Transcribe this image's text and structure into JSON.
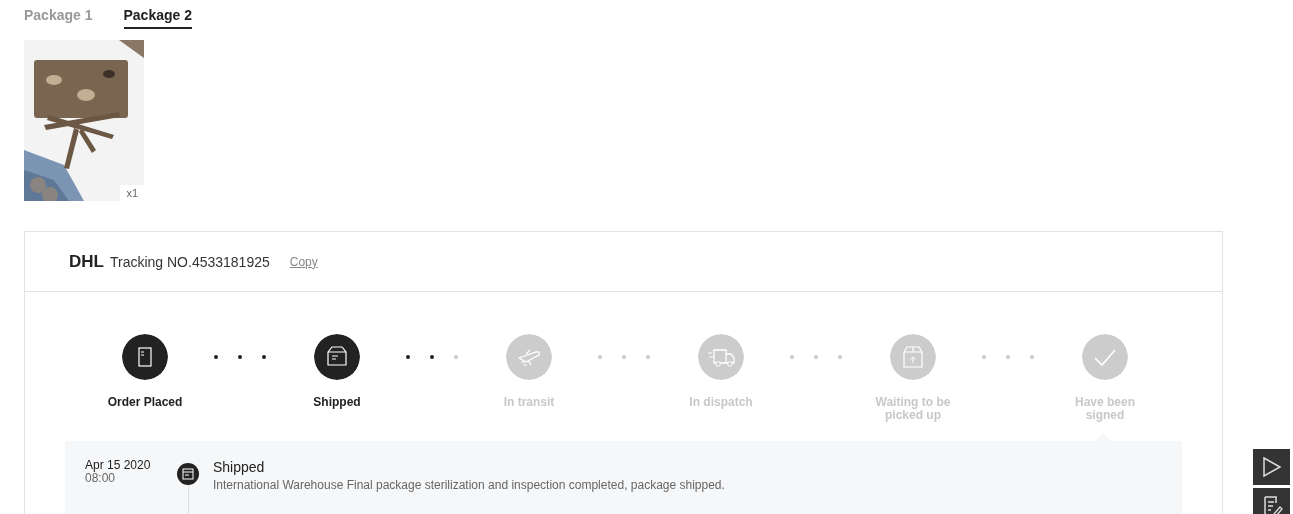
{
  "tabs": [
    {
      "label": "Package 1",
      "selected": false
    },
    {
      "label": "Package 2",
      "selected": true
    }
  ],
  "items": [
    {
      "kind": "picture",
      "quantity": "x1"
    }
  ],
  "tracking": {
    "carrier": "DHL",
    "number_label": "Tracking NO.4533181925",
    "copy": "Copy"
  },
  "steps": [
    {
      "label": "Order Placed",
      "done": true
    },
    {
      "label": "Shipped",
      "done": true
    },
    {
      "label": "In transit",
      "done": false
    },
    {
      "label": "In dispatch",
      "done": false
    },
    {
      "label": "Waiting to be picked up",
      "done": false
    },
    {
      "label": "Have been signed",
      "done": false
    }
  ],
  "events": [
    {
      "date": "Apr 15 2020",
      "time": "08:00",
      "title": "Shipped",
      "detail": "International Warehouse Final package sterilization and inspection completed, package shipped."
    }
  ]
}
